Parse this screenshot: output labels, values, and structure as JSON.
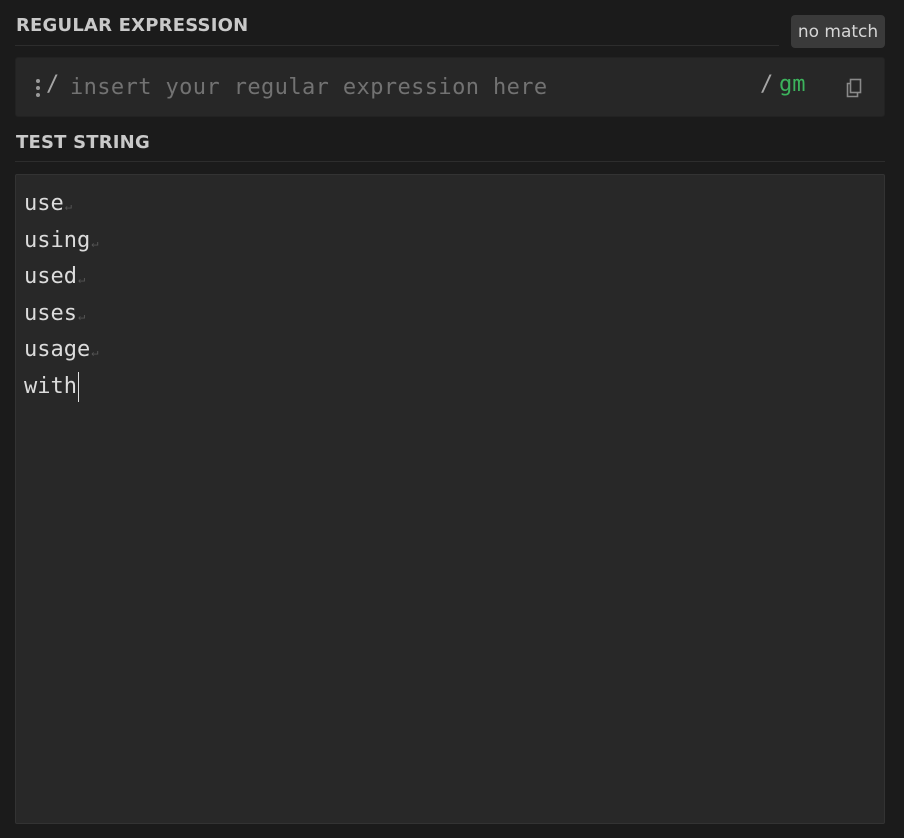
{
  "regex_section": {
    "title": "REGULAR EXPRESSION",
    "match_status": "no match",
    "delimiter_open": "/",
    "placeholder": "insert your regular expression here",
    "value": "",
    "delimiter_close": "/",
    "flags": "gm",
    "flags_color": "#3cb35c",
    "copy_icon": "copy-icon",
    "drag_icon": "drag-handle-icon"
  },
  "test_section": {
    "title": "TEST STRING",
    "newline_glyph": "↵",
    "lines": [
      "use",
      "using",
      "used",
      "uses",
      "usage",
      "with"
    ]
  }
}
